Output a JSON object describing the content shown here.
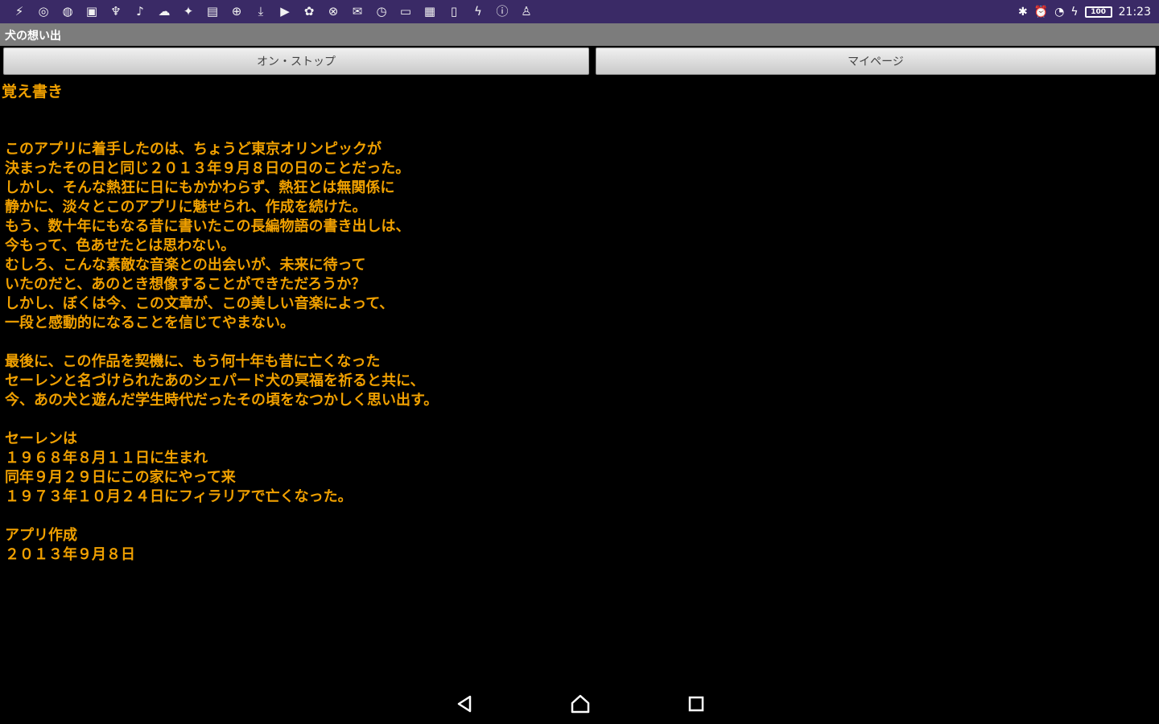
{
  "status_bar": {
    "notification_icons": [
      "usb-icon",
      "chrome-icon",
      "globe-icon",
      "gallery-icon",
      "usb-debug-icon",
      "mic-icon",
      "cloud-icon",
      "twitter-icon",
      "picture-icon",
      "download-circle-icon",
      "download-icon",
      "youtube-icon",
      "settings-icon",
      "earth-icon",
      "mail-icon",
      "clock-icon",
      "message-icon",
      "photo-icon",
      "tablet-icon",
      "flash-icon",
      "info-icon",
      "hand-icon"
    ],
    "time": "21:23",
    "battery": "100"
  },
  "app": {
    "title": "犬の想い出"
  },
  "buttons": {
    "on_stop": "オン・ストップ",
    "my_page": "マイページ"
  },
  "content": {
    "heading": "覚え書き",
    "paragraph1": "このアプリに着手したのは、ちょうど東京オリンピックが\n決まったその日と同じ２０１３年９月８日の日のことだった。\nしかし、そんな熱狂に日にもかかわらず、熱狂とは無関係に\n静かに、淡々とこのアプリに魅せられ、作成を続けた。\nもう、数十年にもなる昔に書いたこの長編物語の書き出しは、\n今もって、色あせたとは思わない。\nむしろ、こんな素敵な音楽との出会いが、未来に待って\nいたのだと、あのとき想像することができただろうか？\nしかし、ぼくは今、この文章が、この美しい音楽によって、\n一段と感動的になることを信じてやまない。",
    "paragraph2": "最後に、この作品を契機に、もう何十年も昔に亡くなった\nセーレンと名づけられたあのシェパード犬の冥福を祈ると共に、\n今、あの犬と遊んだ学生時代だったその頃をなつかしく思い出す。",
    "paragraph3": "セーレンは\n１９６８年８月１１日に生まれ\n同年９月２９日にこの家にやって来\n１９７３年１０月２４日にフィラリアで亡くなった。",
    "paragraph4": "アプリ作成\n２０１３年９月８日"
  },
  "colors": {
    "status_bar": "#3a2a66",
    "title_bar": "#7c7c7c",
    "text": "#f0a000",
    "background": "#000000"
  }
}
